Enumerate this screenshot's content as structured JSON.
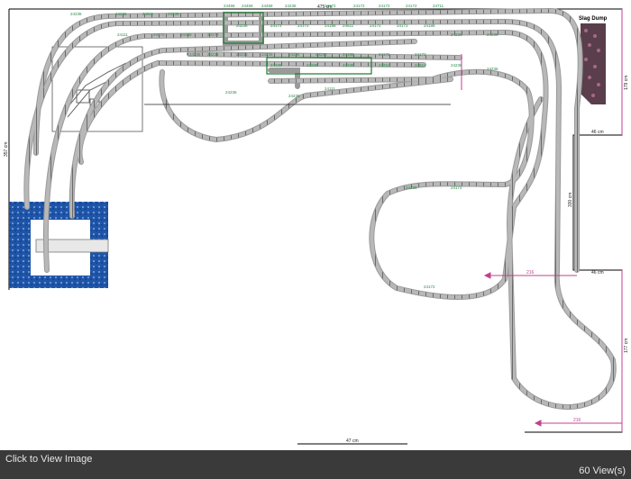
{
  "footer": {
    "click_label": "Click to View Image",
    "views_label": "60 View(s)"
  },
  "diagram": {
    "slag_label": "Slag Dump",
    "dims": {
      "top": "475 cm",
      "bottom": "47 cm",
      "mid_a": "216",
      "mid_b": "216",
      "right_a": "46 cm",
      "right_b": "46 cm",
      "left_v": "357 cm",
      "right_v1": "179 cm",
      "right_v2": "330 cm",
      "right_v3": "177 cm"
    },
    "track_labels": [
      "24236",
      "24236",
      "24611",
      "24236",
      "24458",
      "24458",
      "24458",
      "24236",
      "24172",
      "24172",
      "24172",
      "24172",
      "24711",
      "24111",
      "24172",
      "24188",
      "24172",
      "24236",
      "24172",
      "24172",
      "24188",
      "24611",
      "24172",
      "24172",
      "24188",
      "24236",
      "24236",
      "24236",
      "24236",
      "24236",
      "24236",
      "24236",
      "24236",
      "24188",
      "24172",
      "24172",
      "24236",
      "24236",
      "24236",
      "24211",
      "24611",
      "24236",
      "24236",
      "24236",
      "24236",
      "24111",
      "24236",
      "24172",
      "24172"
    ],
    "colors": {
      "track": "#8c8c8c",
      "tie": "#555555",
      "water": "#1f55a8",
      "label": "#2c8a4a",
      "dim_pink": "#c2408f"
    }
  }
}
